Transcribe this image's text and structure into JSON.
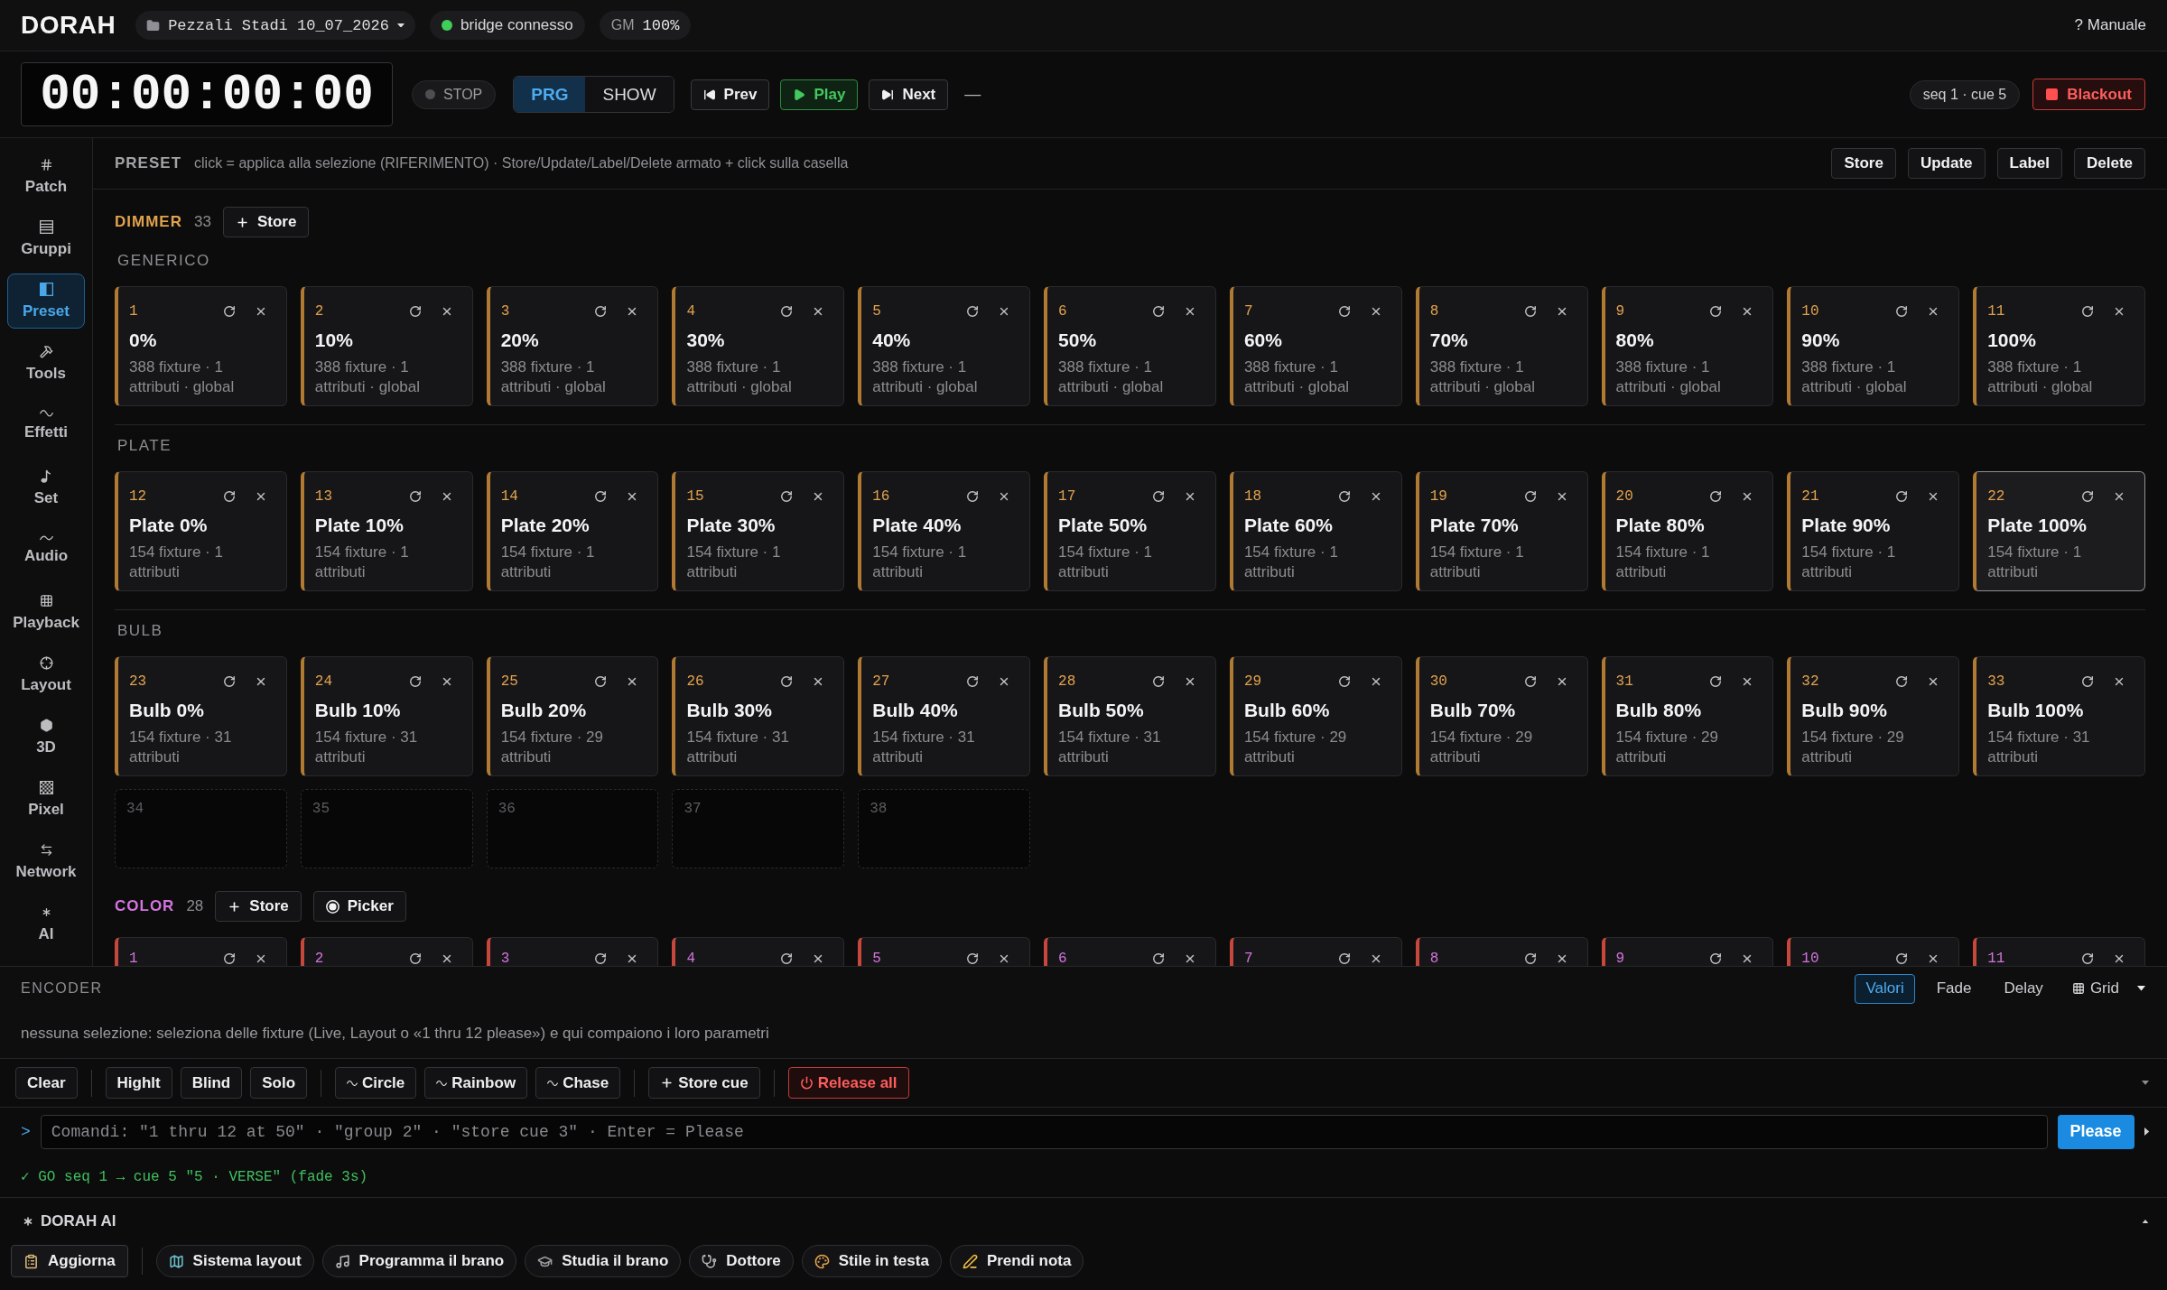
{
  "topbar": {
    "logo": "DORAH",
    "project": "Pezzali Stadi 10_07_2026",
    "bridge": {
      "label": "bridge connesso",
      "connected": true
    },
    "gm": {
      "label": "GM",
      "value": "100%"
    },
    "help": "? Manuale"
  },
  "transport": {
    "timecode": "00:00:00:00",
    "stop": "STOP",
    "modes": [
      {
        "label": "PRG",
        "selected": true
      },
      {
        "label": "SHOW",
        "selected": false
      }
    ],
    "buttons": [
      {
        "label": "Prev",
        "kind": "prev"
      },
      {
        "label": "Play",
        "kind": "play"
      },
      {
        "label": "Next",
        "kind": "next"
      }
    ],
    "separator": "—",
    "cue": "seq 1 · cue 5",
    "blackout": "Blackout"
  },
  "sidebar": {
    "items": [
      {
        "label": "Patch",
        "selected": false
      },
      {
        "label": "Gruppi",
        "selected": false
      },
      {
        "label": "Preset",
        "selected": true
      },
      {
        "label": "Tools",
        "selected": false
      },
      {
        "label": "Effetti",
        "selected": false
      },
      {
        "label": "Set",
        "selected": false
      },
      {
        "label": "Audio",
        "selected": false
      },
      {
        "label": "Playback",
        "selected": false
      },
      {
        "label": "Layout",
        "selected": false
      },
      {
        "label": "3D",
        "selected": false
      },
      {
        "label": "Pixel",
        "selected": false
      },
      {
        "label": "Network",
        "selected": false
      },
      {
        "label": "AI",
        "selected": false
      }
    ]
  },
  "preset_bar": {
    "title": "PRESET",
    "hint": "click = applica alla selezione (RIFERIMENTO) · Store/Update/Label/Delete armato + click sulla casella",
    "buttons": [
      "Store",
      "Update",
      "Label",
      "Delete"
    ]
  },
  "families": [
    {
      "kind": "dimmer",
      "name": "DIMMER",
      "color": "#e3a24c",
      "count": "33",
      "buttons": [
        {
          "label": "Store",
          "kind": "store"
        }
      ],
      "groups": [
        {
          "name": "GENERICO",
          "cards": [
            {
              "kind": "preset",
              "num": "1",
              "title": "0%",
              "info": "388 fixture · 1 attributi · global",
              "selected": false
            },
            {
              "kind": "preset",
              "num": "2",
              "title": "10%",
              "info": "388 fixture · 1 attributi · global",
              "selected": false
            },
            {
              "kind": "preset",
              "num": "3",
              "title": "20%",
              "info": "388 fixture · 1 attributi · global",
              "selected": false
            },
            {
              "kind": "preset",
              "num": "4",
              "title": "30%",
              "info": "388 fixture · 1 attributi · global",
              "selected": false
            },
            {
              "kind": "preset",
              "num": "5",
              "title": "40%",
              "info": "388 fixture · 1 attributi · global",
              "selected": false
            },
            {
              "kind": "preset",
              "num": "6",
              "title": "50%",
              "info": "388 fixture · 1 attributi · global",
              "selected": false
            },
            {
              "kind": "preset",
              "num": "7",
              "title": "60%",
              "info": "388 fixture · 1 attributi · global",
              "selected": false
            },
            {
              "kind": "preset",
              "num": "8",
              "title": "70%",
              "info": "388 fixture · 1 attributi · global",
              "selected": false
            },
            {
              "kind": "preset",
              "num": "9",
              "title": "80%",
              "info": "388 fixture · 1 attributi · global",
              "selected": false
            },
            {
              "kind": "preset",
              "num": "10",
              "title": "90%",
              "info": "388 fixture · 1 attributi · global",
              "selected": false
            },
            {
              "kind": "preset",
              "num": "11",
              "title": "100%",
              "info": "388 fixture · 1 attributi · global",
              "selected": false
            }
          ]
        },
        {
          "name": "PLATE",
          "cards": [
            {
              "kind": "preset",
              "num": "12",
              "title": "Plate 0%",
              "info": "154 fixture · 1 attributi",
              "selected": false
            },
            {
              "kind": "preset",
              "num": "13",
              "title": "Plate 10%",
              "info": "154 fixture · 1 attributi",
              "selected": false
            },
            {
              "kind": "preset",
              "num": "14",
              "title": "Plate 20%",
              "info": "154 fixture · 1 attributi",
              "selected": false
            },
            {
              "kind": "preset",
              "num": "15",
              "title": "Plate 30%",
              "info": "154 fixture · 1 attributi",
              "selected": false
            },
            {
              "kind": "preset",
              "num": "16",
              "title": "Plate 40%",
              "info": "154 fixture · 1 attributi",
              "selected": false
            },
            {
              "kind": "preset",
              "num": "17",
              "title": "Plate 50%",
              "info": "154 fixture · 1 attributi",
              "selected": false
            },
            {
              "kind": "preset",
              "num": "18",
              "title": "Plate 60%",
              "info": "154 fixture · 1 attributi",
              "selected": false
            },
            {
              "kind": "preset",
              "num": "19",
              "title": "Plate 70%",
              "info": "154 fixture · 1 attributi",
              "selected": false
            },
            {
              "kind": "preset",
              "num": "20",
              "title": "Plate 80%",
              "info": "154 fixture · 1 attributi",
              "selected": false
            },
            {
              "kind": "preset",
              "num": "21",
              "title": "Plate 90%",
              "info": "154 fixture · 1 attributi",
              "selected": false
            },
            {
              "kind": "preset",
              "num": "22",
              "title": "Plate 100%",
              "info": "154 fixture · 1 attributi",
              "selected": true
            }
          ]
        },
        {
          "name": "BULB",
          "cards": [
            {
              "kind": "preset",
              "num": "23",
              "title": "Bulb 0%",
              "info": "154 fixture · 31 attributi",
              "selected": false
            },
            {
              "kind": "preset",
              "num": "24",
              "title": "Bulb 10%",
              "info": "154 fixture · 31 attributi",
              "selected": false
            },
            {
              "kind": "preset",
              "num": "25",
              "title": "Bulb 20%",
              "info": "154 fixture · 29 attributi",
              "selected": false
            },
            {
              "kind": "preset",
              "num": "26",
              "title": "Bulb 30%",
              "info": "154 fixture · 31 attributi",
              "selected": false
            },
            {
              "kind": "preset",
              "num": "27",
              "title": "Bulb 40%",
              "info": "154 fixture · 31 attributi",
              "selected": false
            },
            {
              "kind": "preset",
              "num": "28",
              "title": "Bulb 50%",
              "info": "154 fixture · 31 attributi",
              "selected": false
            },
            {
              "kind": "preset",
              "num": "29",
              "title": "Bulb 60%",
              "info": "154 fixture · 29 attributi",
              "selected": false
            },
            {
              "kind": "preset",
              "num": "30",
              "title": "Bulb 70%",
              "info": "154 fixture · 29 attributi",
              "selected": false
            },
            {
              "kind": "preset",
              "num": "31",
              "title": "Bulb 80%",
              "info": "154 fixture · 29 attributi",
              "selected": false
            },
            {
              "kind": "preset",
              "num": "32",
              "title": "Bulb 90%",
              "info": "154 fixture · 29 attributi",
              "selected": false
            },
            {
              "kind": "preset",
              "num": "33",
              "title": "Bulb 100%",
              "info": "154 fixture · 31 attributi",
              "selected": false
            },
            {
              "kind": "empty",
              "num": "34",
              "selected": false
            },
            {
              "kind": "empty",
              "num": "35",
              "selected": false
            },
            {
              "kind": "empty",
              "num": "36",
              "selected": false
            },
            {
              "kind": "empty",
              "num": "37",
              "selected": false
            },
            {
              "kind": "empty",
              "num": "38",
              "selected": false
            }
          ]
        }
      ]
    },
    {
      "kind": "color",
      "name": "COLOR",
      "color": "#d374dc",
      "count": "28",
      "buttons": [
        {
          "label": "Store",
          "kind": "store"
        },
        {
          "label": "Picker",
          "kind": "picker"
        }
      ],
      "cards": [
        {
          "kind": "preset",
          "num": "1",
          "selected": false
        },
        {
          "kind": "preset",
          "num": "2",
          "selected": false
        },
        {
          "kind": "preset",
          "num": "3",
          "selected": false
        },
        {
          "kind": "preset",
          "num": "4",
          "selected": false
        },
        {
          "kind": "preset",
          "num": "5",
          "selected": false
        },
        {
          "kind": "preset",
          "num": "6",
          "selected": false
        },
        {
          "kind": "preset",
          "num": "7",
          "selected": false
        },
        {
          "kind": "preset",
          "num": "8",
          "selected": false
        },
        {
          "kind": "preset",
          "num": "9",
          "selected": false
        },
        {
          "kind": "preset",
          "num": "10",
          "selected": false
        },
        {
          "kind": "preset",
          "num": "11",
          "selected": false
        }
      ]
    }
  ],
  "encoder": {
    "title": "ENCODER",
    "tabs": [
      {
        "label": "Valori",
        "selected": true
      },
      {
        "label": "Fade",
        "selected": false
      },
      {
        "label": "Delay",
        "selected": false
      }
    ],
    "grid": "Grid",
    "message": "nessuna selezione: seleziona delle fixture (Live, Layout o «1 thru 12 please») e qui compaiono i loro parametri"
  },
  "toolbar": {
    "groups": [
      {
        "buttons": [
          {
            "label": "Clear",
            "kind": "plain"
          }
        ]
      },
      {
        "buttons": [
          {
            "label": "Highlt",
            "kind": "plain"
          },
          {
            "label": "Blind",
            "kind": "plain"
          },
          {
            "label": "Solo",
            "kind": "plain"
          }
        ]
      },
      {
        "buttons": [
          {
            "label": "Circle",
            "kind": "effect"
          },
          {
            "label": "Rainbow",
            "kind": "effect"
          },
          {
            "label": "Chase",
            "kind": "effect"
          }
        ]
      },
      {
        "buttons": [
          {
            "label": "Store cue",
            "kind": "add"
          }
        ]
      },
      {
        "buttons": [
          {
            "label": "Release all",
            "kind": "danger"
          }
        ]
      }
    ]
  },
  "command": {
    "prompt": ">",
    "placeholder": "Comandi: \"1 thru 12 at 50\" · \"group 2\" · \"store cue 3\" · Enter = Please",
    "submit": "Please"
  },
  "log": "✓ GO seq 1 → cue 5 \"5 · VERSE\" (fade 3s)",
  "ai": {
    "title": "DORAH AI",
    "expanded": true,
    "actions": [
      {
        "label": "Aggiorna",
        "kind": "refresh"
      },
      {
        "label": "Sistema layout",
        "kind": "skill"
      },
      {
        "label": "Programma il brano",
        "kind": "skill"
      },
      {
        "label": "Studia il brano",
        "kind": "skill"
      },
      {
        "label": "Dottore",
        "kind": "skill"
      },
      {
        "label": "Stile in testa",
        "kind": "skill"
      },
      {
        "label": "Prendi nota",
        "kind": "skill"
      }
    ]
  }
}
